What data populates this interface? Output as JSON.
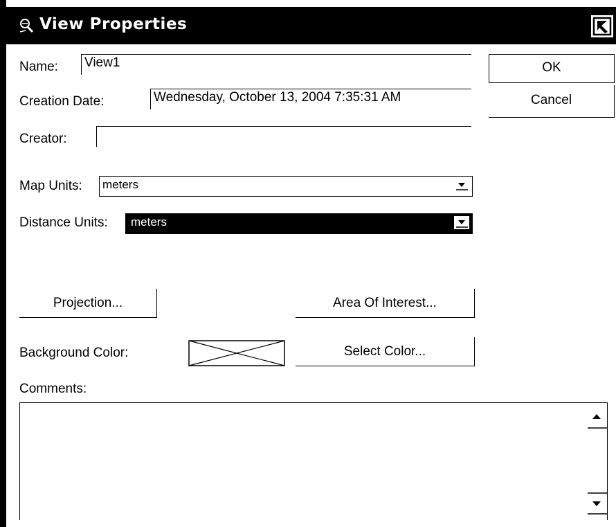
{
  "window": {
    "title": "View Properties",
    "title_icon": "magnifier-icon",
    "close_icon": "close-icon"
  },
  "fields": {
    "name_label": "Name:",
    "name_value": "View1",
    "creation_date_label": "Creation Date:",
    "creation_date_value": "Wednesday, October 13, 2004 7:35:31 AM",
    "creator_label": "Creator:",
    "creator_value": ""
  },
  "units": {
    "map_units_label": "Map Units:",
    "map_units_value": "meters",
    "distance_units_label": "Distance Units:",
    "distance_units_value": "meters"
  },
  "buttons": {
    "ok": "OK",
    "cancel": "Cancel",
    "projection": "Projection...",
    "area_of_interest": "Area Of Interest...",
    "select_color": "Select Color..."
  },
  "background": {
    "label": "Background Color:",
    "swatch": "none"
  },
  "comments": {
    "label": "Comments:",
    "value": ""
  }
}
